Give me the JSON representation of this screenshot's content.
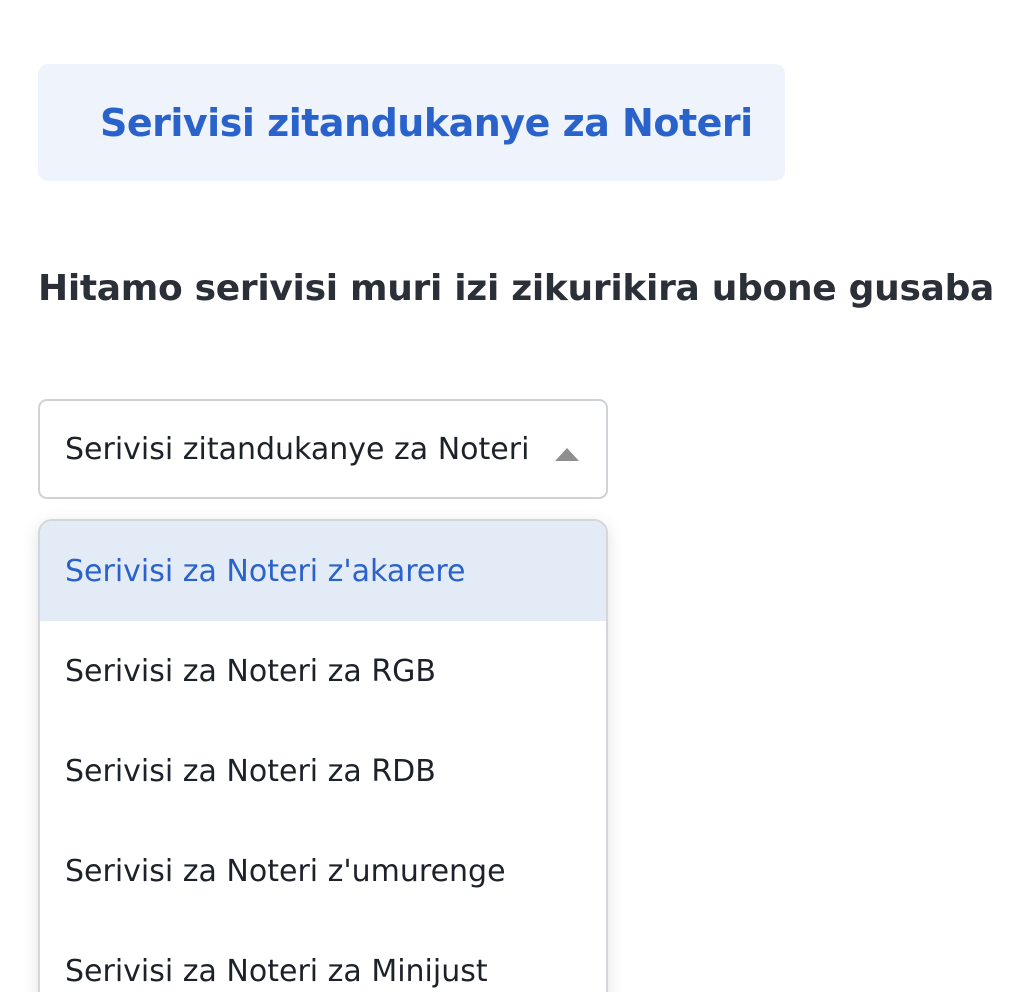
{
  "banner": {
    "title": "Serivisi zitandukanye za Noteri"
  },
  "heading": "Hitamo serivisi muri izi zikurikira ubone gusaba",
  "dropdown": {
    "selected_value": "Serivisi zitandukanye za Noteri",
    "arrow_icon": "caret-up-icon",
    "expanded": true,
    "options": [
      {
        "label": "Serivisi za Noteri z'akarere",
        "highlighted": true
      },
      {
        "label": "Serivisi za Noteri za RGB",
        "highlighted": false
      },
      {
        "label": "Serivisi za Noteri za RDB",
        "highlighted": false
      },
      {
        "label": "Serivisi za Noteri z'umurenge",
        "highlighted": false
      },
      {
        "label": "Serivisi za Noteri za Minijust",
        "highlighted": false
      }
    ]
  },
  "colors": {
    "accent": "#2a62cc",
    "banner_bg": "#eef3fc",
    "highlight_bg": "#e3ebf6",
    "text": "#1d2129",
    "border": "#cfd2d6"
  }
}
